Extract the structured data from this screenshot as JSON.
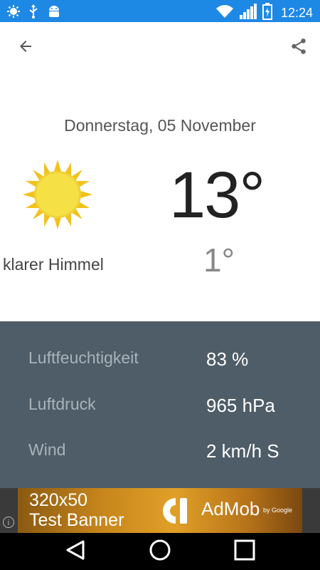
{
  "status_bar": {
    "time": "12:24",
    "left_icons": [
      "brightness-icon",
      "usb-icon",
      "android-debug-icon"
    ],
    "right_icons": [
      "wifi-icon",
      "signal-icon",
      "battery-charging-icon"
    ],
    "color": "#1e88e5"
  },
  "toolbar": {
    "back_icon": "arrow-back-icon",
    "share_icon": "share-icon"
  },
  "weather": {
    "date": "Donnerstag, 05 November",
    "temp_max": "13°",
    "temp_min": "1°",
    "condition": "klarer Himmel",
    "icon": "sun-icon"
  },
  "details": {
    "background": "#4e5d68",
    "rows": [
      {
        "label": "Luftfeuchtigkeit",
        "value": "83 %"
      },
      {
        "label": "Luftdruck",
        "value": "965 hPa"
      },
      {
        "label": "Wind",
        "value": "2 km/h S"
      }
    ]
  },
  "ad": {
    "size_text": "320x50",
    "test_text": "Test Banner",
    "brand": "AdMob",
    "by": "by Google"
  },
  "nav": {
    "icons": [
      "back-triangle-icon",
      "home-circle-icon",
      "recents-square-icon"
    ]
  }
}
